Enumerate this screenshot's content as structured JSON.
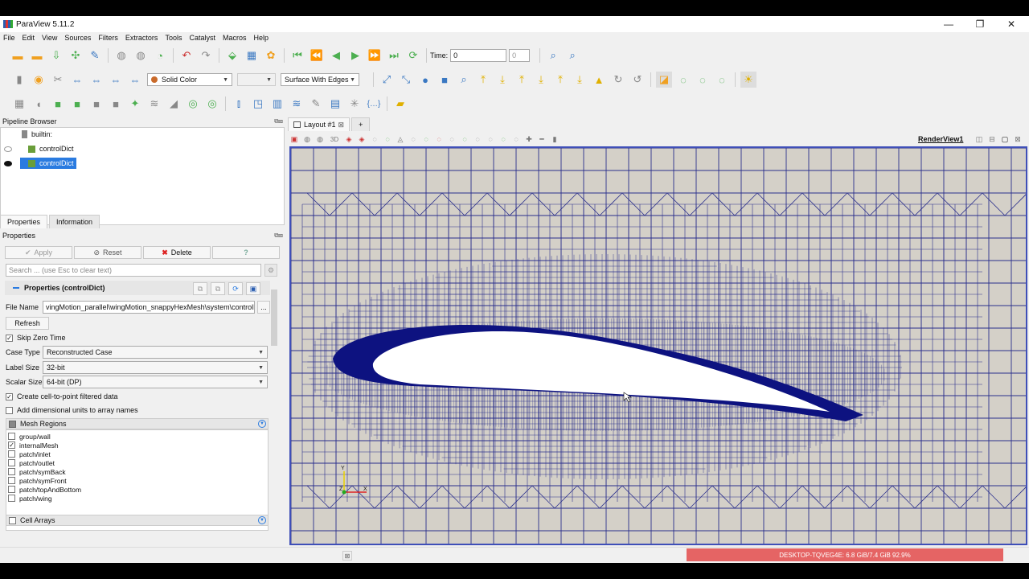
{
  "window": {
    "title": "ParaView 5.11.2",
    "minimize": "—",
    "restore": "❐",
    "close": "✕"
  },
  "menu": [
    "File",
    "Edit",
    "View",
    "Sources",
    "Filters",
    "Extractors",
    "Tools",
    "Catalyst",
    "Macros",
    "Help"
  ],
  "toolbar": {
    "time_label": "Time:",
    "time_value": "0",
    "time_index": "0",
    "color_by": "Solid Color",
    "representation": "Surface With Edges"
  },
  "pipeline": {
    "title": "Pipeline Browser",
    "root": "builtin:",
    "items": [
      "controlDict",
      "controlDict"
    ]
  },
  "tabs": {
    "properties": "Properties",
    "information": "Information"
  },
  "properties": {
    "title": "Properties",
    "apply": "Apply",
    "reset": "Reset",
    "delete": "Delete",
    "help": "?",
    "search_placeholder": "Search ... (use Esc to clear text)",
    "section": "Properties (controlDict)",
    "file_name_label": "File Name",
    "file_name_value": "vingMotion_parallel\\wingMotion_snappyHexMesh\\system\\controlDict",
    "browse": "...",
    "refresh": "Refresh",
    "skip_zero_time": "Skip Zero Time",
    "case_type_label": "Case Type",
    "case_type_value": "Reconstructed Case",
    "label_size_label": "Label Size",
    "label_size_value": "32-bit",
    "scalar_size_label": "Scalar Size",
    "scalar_size_value": "64-bit (DP)",
    "create_c2p": "Create cell-to-point filtered data",
    "add_dim_units": "Add dimensional units to array names",
    "mesh_regions_label": "Mesh Regions",
    "mesh_regions": [
      "group/wall",
      "internalMesh",
      "patch/inlet",
      "patch/outlet",
      "patch/symBack",
      "patch/symFront",
      "patch/topAndBottom",
      "patch/wing"
    ],
    "cell_arrays_label": "Cell Arrays"
  },
  "layout": {
    "tab": "Layout #1",
    "close": "⊠",
    "add": "+",
    "render_view": "RenderView1",
    "toolbar_3d": "3D"
  },
  "axes": {
    "y": "Y",
    "z": "Z",
    "x": "X"
  },
  "status": {
    "memory": "DESKTOP-TQVEG4E: 6.8 GiB/7.4 GiB 92.9%",
    "memory_fraction": 0.929
  },
  "colors": {
    "mesh": "#2a2f8c",
    "wing_fill": "#ffffff",
    "wing_edge": "#0d1280",
    "background": "#d4d0c8",
    "memory_bar": "#e56464"
  }
}
